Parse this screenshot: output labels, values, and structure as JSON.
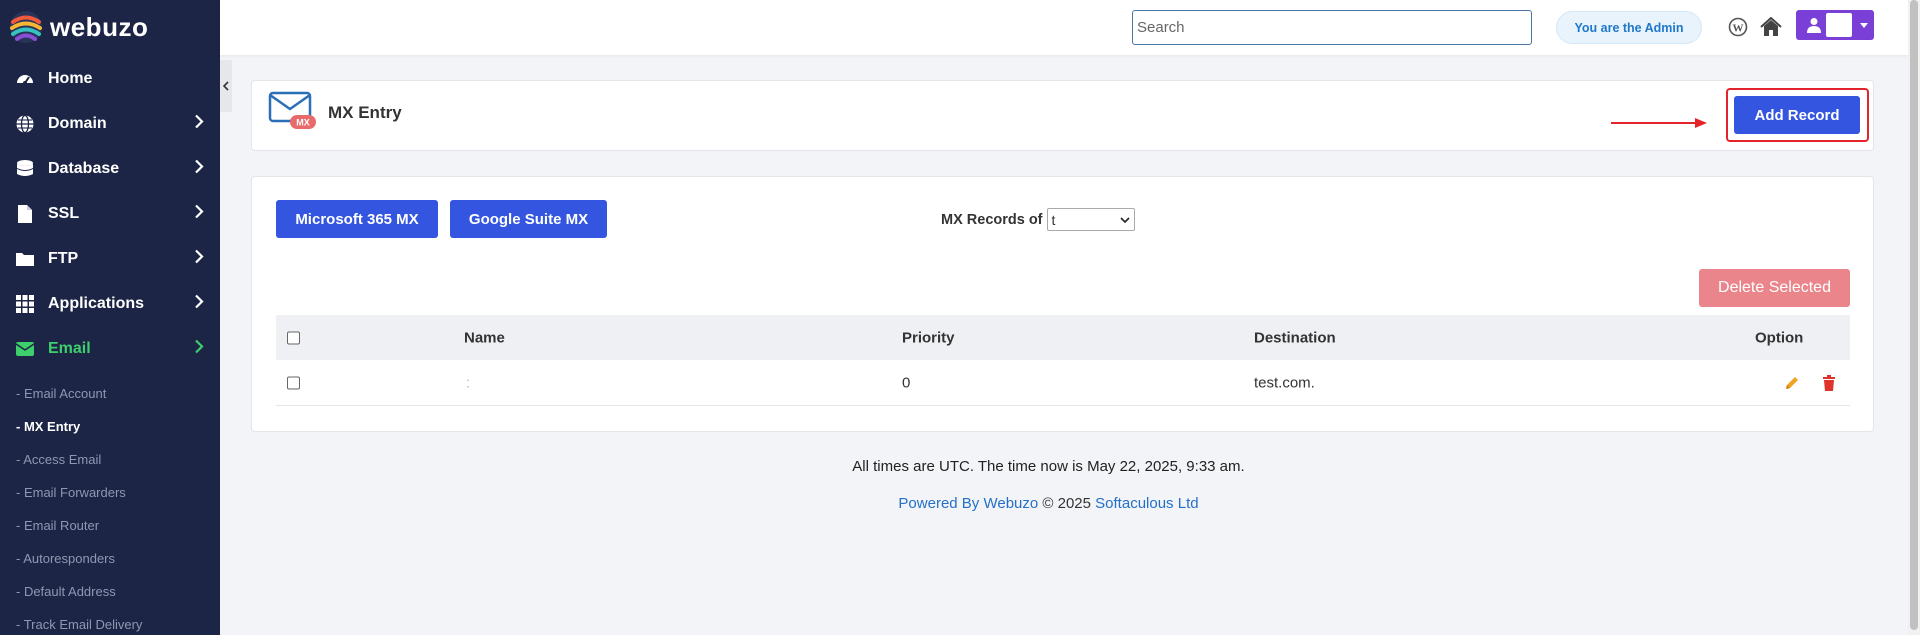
{
  "brand": {
    "name": "webuzo"
  },
  "sidebar": {
    "items": [
      {
        "label": "Home",
        "icon": "dashboard-icon",
        "has_chevron": false
      },
      {
        "label": "Domain",
        "icon": "globe-icon",
        "has_chevron": true
      },
      {
        "label": "Database",
        "icon": "database-icon",
        "has_chevron": true
      },
      {
        "label": "SSL",
        "icon": "file-icon",
        "has_chevron": true
      },
      {
        "label": "FTP",
        "icon": "folder-icon",
        "has_chevron": true
      },
      {
        "label": "Applications",
        "icon": "grid-icon",
        "has_chevron": true
      },
      {
        "label": "Email",
        "icon": "envelope-icon",
        "has_chevron": true,
        "active": true
      }
    ],
    "sub_items": [
      {
        "label": "- Email Account"
      },
      {
        "label": "- MX Entry",
        "active": true
      },
      {
        "label": "- Access Email"
      },
      {
        "label": "- Email Forwarders"
      },
      {
        "label": "- Email Router"
      },
      {
        "label": "- Autoresponders"
      },
      {
        "label": "- Default Address"
      },
      {
        "label": "- Track Email Delivery"
      }
    ]
  },
  "header": {
    "search_placeholder": "Search",
    "admin_label": "You are the Admin",
    "icons": [
      "wordpress-icon",
      "home-icon",
      "user-icon"
    ]
  },
  "page": {
    "title": "MX Entry",
    "icon_badge": "MX",
    "add_record_label": "Add Record"
  },
  "records": {
    "microsoft_button": "Microsoft 365 MX",
    "google_button": "Google Suite MX",
    "records_of_label": "MX Records of",
    "records_of_value": "t",
    "delete_selected_label": "Delete Selected",
    "columns": {
      "name": "Name",
      "priority": "Priority",
      "destination": "Destination",
      "option": "Option"
    },
    "rows": [
      {
        "name": ":",
        "priority": "0",
        "destination": "test.com."
      }
    ]
  },
  "footer": {
    "time_text": "All times are UTC. The time now is May 22, 2025, 9:33 am.",
    "powered_by": "Powered By Webuzo",
    "copyright": " © 2025 ",
    "company": "Softaculous Ltd"
  },
  "colors": {
    "sidebar_bg": "#1c2545",
    "primary": "#3355e0",
    "active_green": "#3ecf6c",
    "danger": "#e4242b",
    "edit_orange": "#f0a321",
    "delete_red": "#e0332b",
    "user_purple": "#7a3fd6"
  }
}
